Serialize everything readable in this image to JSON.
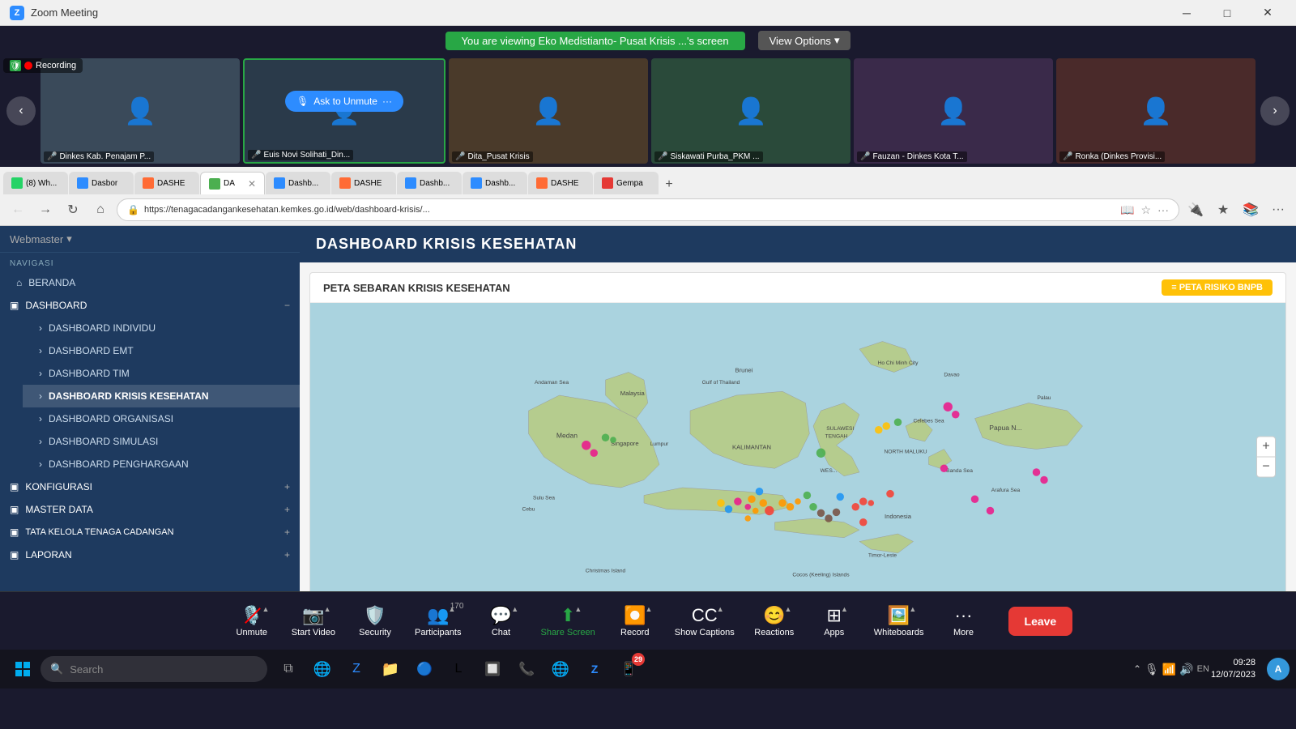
{
  "titlebar": {
    "app_name": "Zoom Meeting",
    "icon": "Z",
    "min_label": "─",
    "max_label": "□",
    "close_label": "✕"
  },
  "share_banner": {
    "message": "You are viewing Eko Medistianto- Pusat Krisis ...'s screen",
    "view_options": "View Options",
    "chevron": "▾"
  },
  "participants": [
    {
      "name": "Dinkes Kab. Penajam P...",
      "emoji": "👤",
      "bg": "#3a4a5a",
      "muted": true
    },
    {
      "name": "Euis Novi Solihati_Din...",
      "emoji": "👤",
      "bg": "#2a3a4a",
      "muted": false,
      "active": true
    },
    {
      "name": "Dita_Pusat Krisis",
      "emoji": "👤",
      "bg": "#4a3a2a",
      "muted": true
    },
    {
      "name": "Siskawati Purba_PKM ...",
      "emoji": "👤",
      "bg": "#2a4a3a",
      "muted": true
    },
    {
      "name": "Fauzan - Dinkes Kota T...",
      "emoji": "👤",
      "bg": "#3a2a4a",
      "muted": true
    },
    {
      "name": "Ronka (Dinkes Provisi...",
      "emoji": "👤",
      "bg": "#4a2a2a",
      "muted": true
    }
  ],
  "recording": {
    "label": "Recording"
  },
  "unmute_btn": "Ask to Unmute",
  "browser": {
    "tabs": [
      {
        "label": "(8) Wh...",
        "icon_color": "#25d366",
        "active": false
      },
      {
        "label": "Dasbor",
        "icon_color": "#2d8cff",
        "active": false
      },
      {
        "label": "DASHE",
        "icon_color": "#ff6b35",
        "active": false
      },
      {
        "label": "DA",
        "icon_color": "#4caf50",
        "active": true,
        "closeable": true
      },
      {
        "label": "Dashb...",
        "icon_color": "#2d8cff",
        "active": false
      },
      {
        "label": "DASHE",
        "icon_color": "#ff6b35",
        "active": false
      },
      {
        "label": "Dashb...",
        "icon_color": "#2d8cff",
        "active": false
      },
      {
        "label": "Dashb...",
        "icon_color": "#2d8cff",
        "active": false
      },
      {
        "label": "DASHE",
        "icon_color": "#ff6b35",
        "active": false
      },
      {
        "label": "Gempa",
        "icon_color": "#e53935",
        "active": false
      }
    ],
    "address": "https://tenagacadangankesehatan.kemkes.go.id/web/dashboard-krisis/...",
    "new_tab": "+"
  },
  "sidebar": {
    "webmaster": "Webmaster",
    "navigasi_label": "NAVIGASI",
    "beranda": "BERANDA",
    "dashboard_label": "DASHBOARD",
    "items": [
      "DASHBOARD INDIVIDU",
      "DASHBOARD EMT",
      "DASHBOARD TIM",
      "DASHBOARD KRISIS KESEHATAN",
      "DASHBOARD ORGANISASI",
      "DASHBOARD SIMULASI",
      "DASHBOARD PENGHARGAAN"
    ],
    "konfigurasi": "KONFIGURASI",
    "master_data": "MASTER DATA",
    "tata_kelola": "TATA KELOLA TENAGA CADANGAN",
    "laporan": "LAPORAN"
  },
  "main": {
    "page_title": "DASHBOARD KRISIS KESEHATAN",
    "map_section_title": "PETA SEBARAN KRISIS KESEHATAN",
    "map_btn": "≡ PETA RISIKO BNPB"
  },
  "taskbar_zoom": {
    "unmute": "Unmute",
    "start_video": "Start Video",
    "security": "Security",
    "participants": "Participants",
    "participants_count": "170",
    "chat": "Chat",
    "share_screen": "Share Screen",
    "record": "Record",
    "show_captions": "Show Captions",
    "reactions": "Reactions",
    "apps": "Apps",
    "whiteboards": "Whiteboards",
    "more": "More",
    "leave": "Leave"
  },
  "win_taskbar": {
    "search_placeholder": "Search",
    "time": "09:28",
    "date": "12/07/2023",
    "notification_count": "29"
  }
}
